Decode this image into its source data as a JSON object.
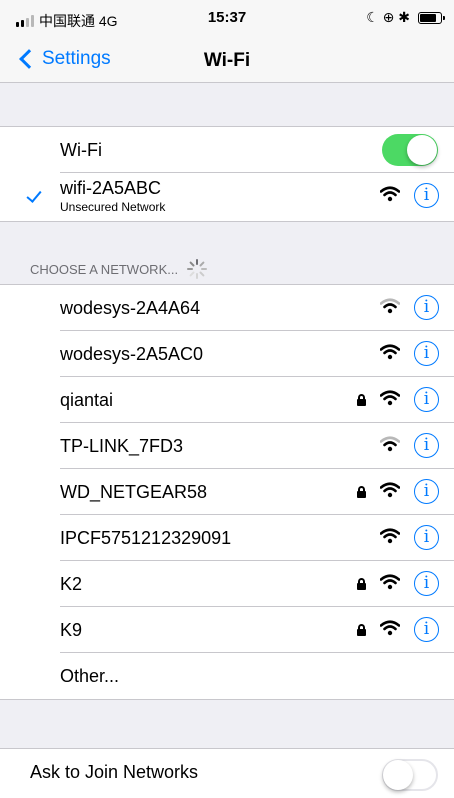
{
  "status": {
    "carrier": "中国联通 4G",
    "time": "15:37",
    "right_icons": "☾ ⊕ ✱"
  },
  "nav": {
    "back_label": "Settings",
    "title": "Wi-Fi"
  },
  "wifi_toggle": {
    "label": "Wi-Fi",
    "on": true
  },
  "connected": {
    "name": "wifi-2A5ABC",
    "subtitle": "Unsecured Network"
  },
  "section_header": "CHOOSE A NETWORK...",
  "networks": [
    {
      "name": "wodesys-2A4A64",
      "locked": false,
      "strength": 2
    },
    {
      "name": "wodesys-2A5AC0",
      "locked": false,
      "strength": 3
    },
    {
      "name": "qiantai",
      "locked": true,
      "strength": 3
    },
    {
      "name": "TP-LINK_7FD3",
      "locked": false,
      "strength": 2
    },
    {
      "name": "WD_NETGEAR58",
      "locked": true,
      "strength": 3
    },
    {
      "name": "IPCF5751212329091",
      "locked": false,
      "strength": 3
    },
    {
      "name": "K2",
      "locked": true,
      "strength": 3
    },
    {
      "name": "K9",
      "locked": true,
      "strength": 3
    }
  ],
  "other_label": "Other...",
  "ask_join": {
    "label": "Ask to Join Networks",
    "on": false
  },
  "colors": {
    "accent": "#007aff",
    "toggle_on": "#4cd964",
    "background": "#efeff4"
  }
}
